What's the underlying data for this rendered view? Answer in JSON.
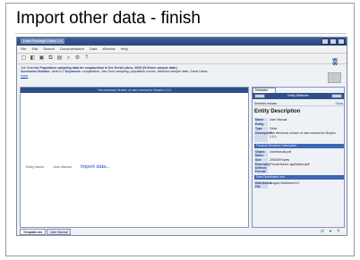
{
  "slide": {
    "title": "Import other data - finish"
  },
  "window": {
    "title": "Data Package Editor 1.0",
    "menu": [
      "File",
      "Edit",
      "Search",
      "Documentation",
      "Data",
      "Window",
      "Help"
    ]
  },
  "toolbar": {
    "icons": [
      "new-icon",
      "open-icon",
      "save-icon",
      "copy-icon",
      "paste-icon",
      "search-icon",
      "settings-icon",
      "help-icon"
    ]
  },
  "document": {
    "authors": "Joe Scientist",
    "title": "Population sampling data for zooplankton in the Great Lakes,  2000 (N-Shore sample data )",
    "accession_label": "Accession Number:",
    "accession": "lamb.5.2",
    "keywords_label": "Keywords:",
    "keywords": "zooplankton, Van Dorn sampling, population curves, fishbone sample data, Great Lakes",
    "more": "more"
  },
  "left_panel": {
    "header": "The electronic Version of user manual for Morpho 1.0.1",
    "entity_name_label": "Entity Name:",
    "entity_name": "User Manual",
    "import_link": "Import data..."
  },
  "right_panel": {
    "tab": "Metadata",
    "entity_bar": "Entity Attributes",
    "release_label": "Selected release",
    "show_link": "Show",
    "heading": "Entity Description",
    "entity_fields": [
      {
        "k": "Name",
        "v": "User Manual"
      },
      {
        "k": "Entity",
        "v": ""
      },
      {
        "k": "Type",
        "v": "Other"
      },
      {
        "k": "Description",
        "v": "The electronic version of user manual for Morpho 1.0.1."
      }
    ],
    "physical_section": "Physical Structure Description",
    "physical_fields": [
      {
        "k": "Object Name",
        "v": "UserManual.pdf"
      },
      {
        "k": "Size",
        "v": "2092459 bytes"
      },
      {
        "k": "Externally Defined Format",
        "v": "Format Name: application/pdf"
      }
    ],
    "distribution_section": "Data Distribution Info",
    "distribution_fields": [
      {
        "k": "Distributed File",
        "v": "ecogrid://knb/lamb.5.2"
      }
    ]
  },
  "bottom_tabs": [
    "Template.xxx",
    "User Manual"
  ]
}
